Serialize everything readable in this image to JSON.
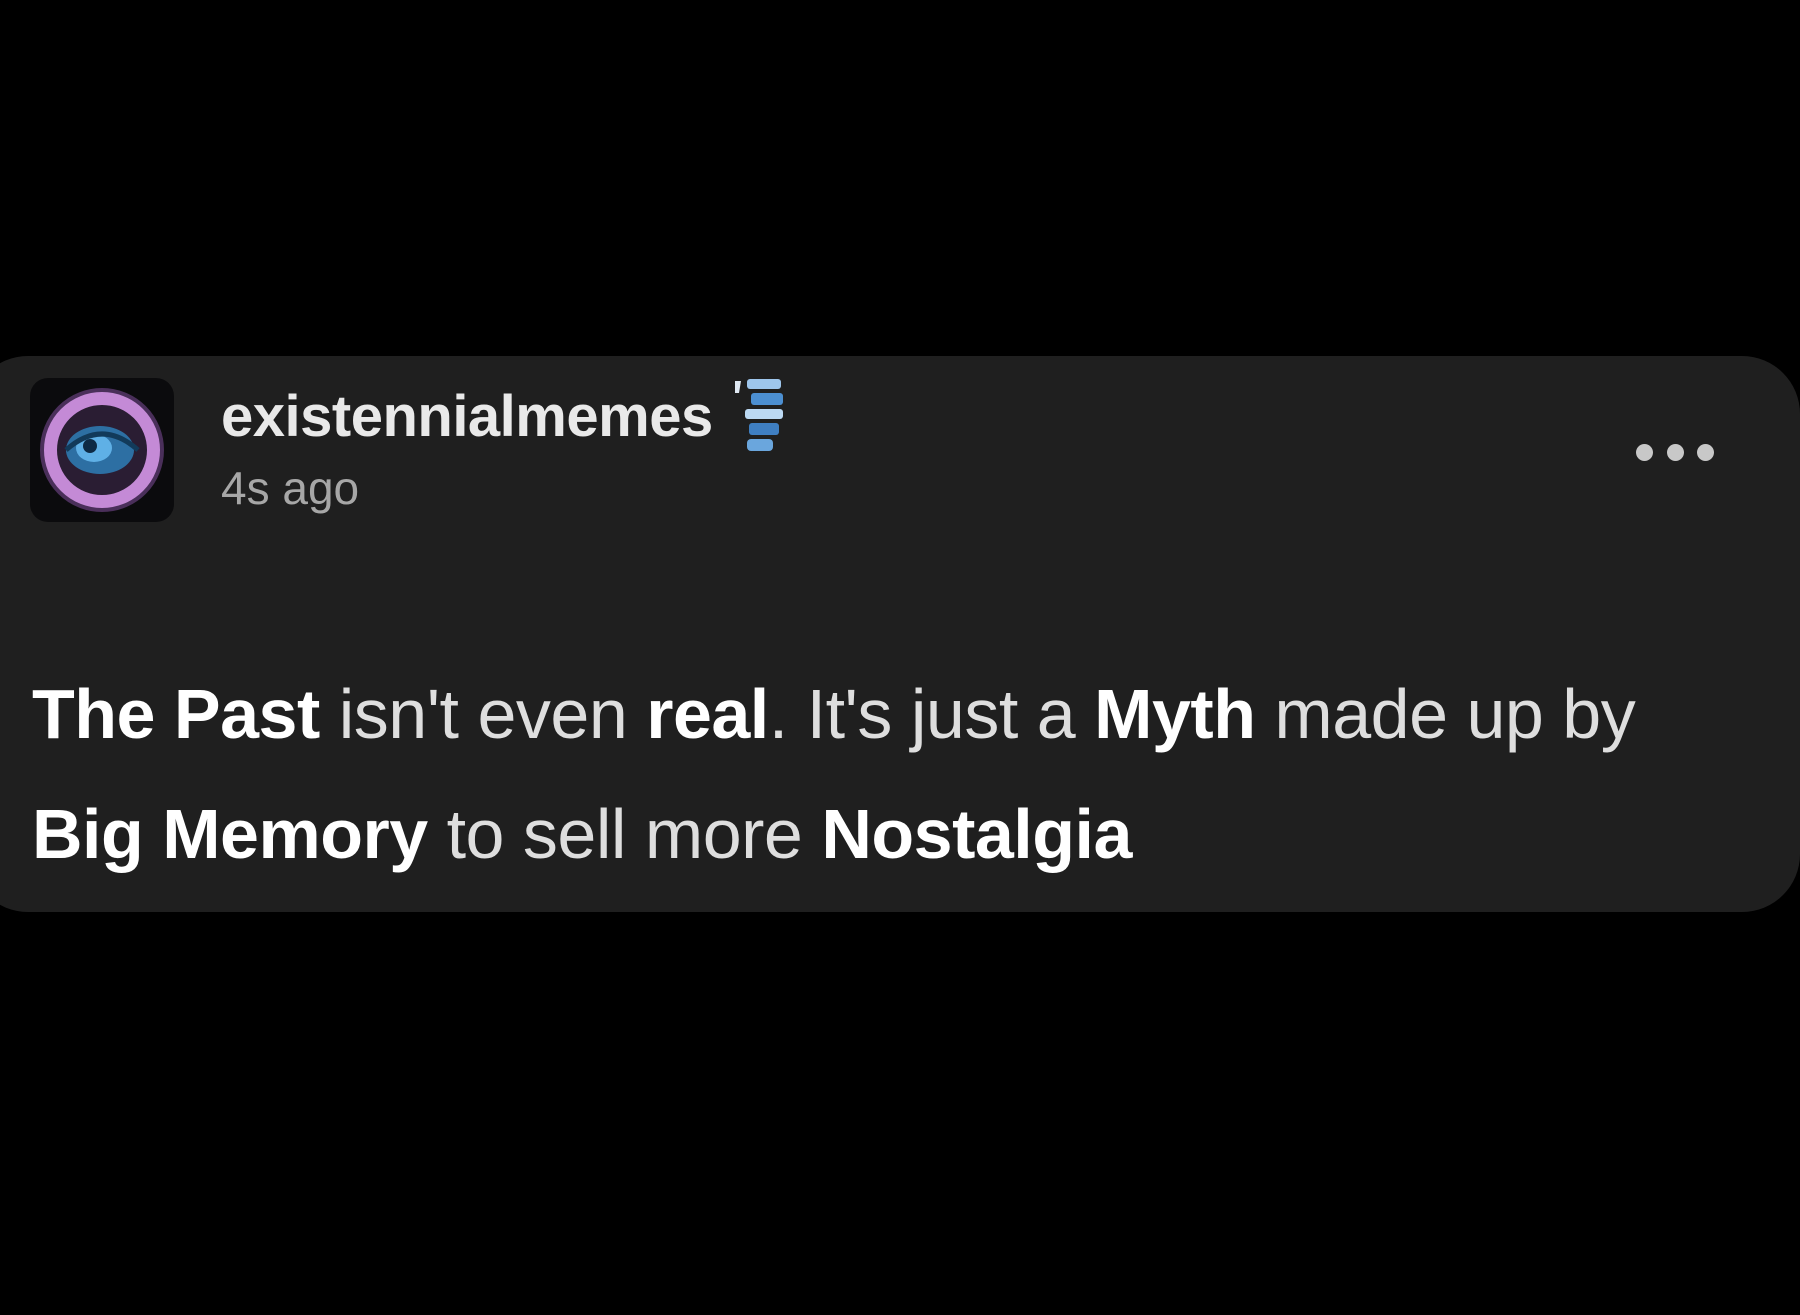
{
  "post": {
    "username": "existennialmemes",
    "timestamp": "4s ago",
    "body_segments": [
      {
        "text": "The Past",
        "bold": true
      },
      {
        "text": " isn't even ",
        "bold": false
      },
      {
        "text": "real",
        "bold": true
      },
      {
        "text": ". It's just a ",
        "bold": false
      },
      {
        "text": "Myth",
        "bold": true
      },
      {
        "text": " made up by ",
        "bold": false
      },
      {
        "text": "Big Memory",
        "bold": true
      },
      {
        "text": " to sell more ",
        "bold": false
      },
      {
        "text": "Nostalgia",
        "bold": true
      }
    ]
  },
  "icons": {
    "avatar": "avatar-eye-icon",
    "badge": "badge-icon",
    "more": "more-options-icon"
  },
  "colors": {
    "page_background": "#000000",
    "card_background": "#1f1f1f",
    "text_primary": "#ffffff",
    "text_secondary": "#a7a7a7"
  }
}
